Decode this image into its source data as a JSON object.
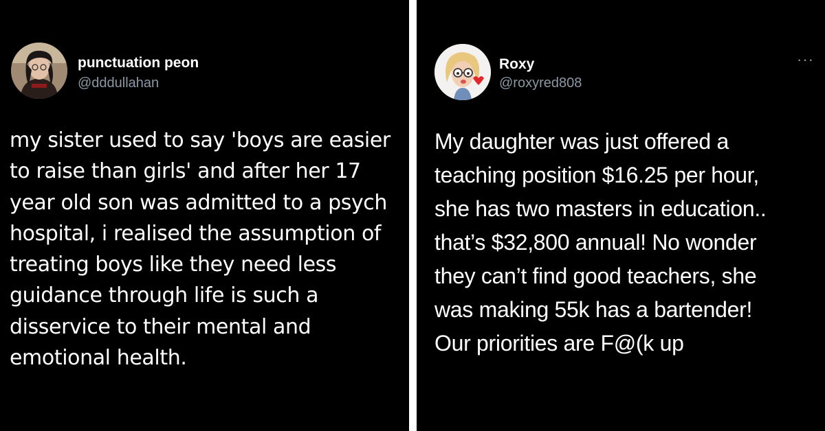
{
  "tweets": [
    {
      "author": {
        "display_name": "punctuation peon",
        "handle": "@dddullahan"
      },
      "text": "my sister used to say 'boys are easier\nto raise than girls' and after her 17\nyear old son was admitted to a psych\nhospital, i realised the assumption of\ntreating boys like they need less\nguidance through life is such a\ndisservice to their mental and\nemotional health."
    },
    {
      "author": {
        "display_name": "Roxy",
        "handle": "@roxyred808"
      },
      "more_label": "···",
      "text": "My daughter was just offered a\nteaching position $16.25 per hour,\nshe has two masters in education..\nthat’s $32,800 annual! No wonder\nthey can’t find good teachers, she\nwas making 55k has a bartender!\nOur priorities are F@(k up"
    }
  ],
  "colors": {
    "background": "#000000",
    "text": "#ffffff",
    "handle": "#8b98a5",
    "divider": "#ffffff"
  },
  "icons": [
    "avatar-photo",
    "avatar-memoji",
    "more-options-icon"
  ]
}
